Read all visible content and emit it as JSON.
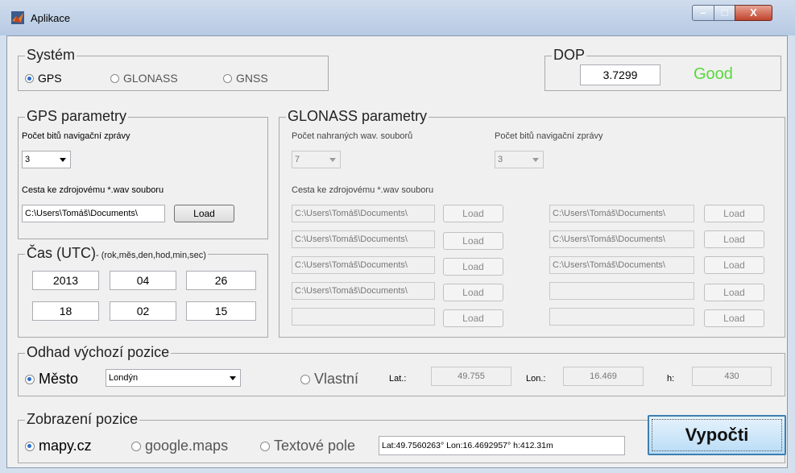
{
  "window": {
    "title": "Aplikace",
    "min_glyph": "–",
    "max_glyph": "□",
    "close_glyph": "X"
  },
  "system": {
    "title": "Systém",
    "options": [
      "GPS",
      "GLONASS",
      "GNSS"
    ],
    "selected": "GPS"
  },
  "dop": {
    "title": "DOP",
    "value": "3.7299",
    "status": "Good",
    "status_color": "#59d83c"
  },
  "gps": {
    "title": "GPS parametry",
    "bits_label": "Počet bitů navigační zprávy",
    "bits_value": "3",
    "path_label": "Cesta ke zdrojovému *.wav souboru",
    "path_value": "C:\\Users\\Tomáš\\Documents\\",
    "load_label": "Load"
  },
  "glonass": {
    "title": "GLONASS parametry",
    "count_label": "Počet nahraných wav. souborů",
    "count_value": "7",
    "bits_label": "Počet bitů navigační zprávy",
    "bits_value": "3",
    "path_label": "Cesta ke zdrojovému *.wav souboru",
    "load_label": "Load",
    "paths_left": [
      "C:\\Users\\Tomáš\\Documents\\",
      "C:\\Users\\Tomáš\\Documents\\",
      "C:\\Users\\Tomáš\\Documents\\",
      "C:\\Users\\Tomáš\\Documents\\",
      ""
    ],
    "paths_right": [
      "C:\\Users\\Tomáš\\Documents\\",
      "C:\\Users\\Tomáš\\Documents\\",
      "C:\\Users\\Tomáš\\Documents\\",
      "",
      ""
    ]
  },
  "time": {
    "title": "Čas (UTC)",
    "hint": "- (rok,měs,den,hod,min,sec)",
    "values": [
      "2013",
      "04",
      "26",
      "18",
      "02",
      "15"
    ]
  },
  "estimate": {
    "title": "Odhad výchozí pozice",
    "city_label": "Město",
    "city_value": "Londýn",
    "custom_label": "Vlastní",
    "lat_label": "Lat.:",
    "lat_value": "49.755",
    "lon_label": "Lon.:",
    "lon_value": "16.469",
    "h_label": "h:",
    "h_value": "430"
  },
  "display": {
    "title": "Zobrazení pozice",
    "options": [
      "mapy.cz",
      "google.maps",
      "Textové pole"
    ],
    "selected": "mapy.cz",
    "result_text": "Lat:49.7560263°  Lon:16.4692957°  h:412.31m"
  },
  "compute": {
    "label": "Vypočti"
  }
}
